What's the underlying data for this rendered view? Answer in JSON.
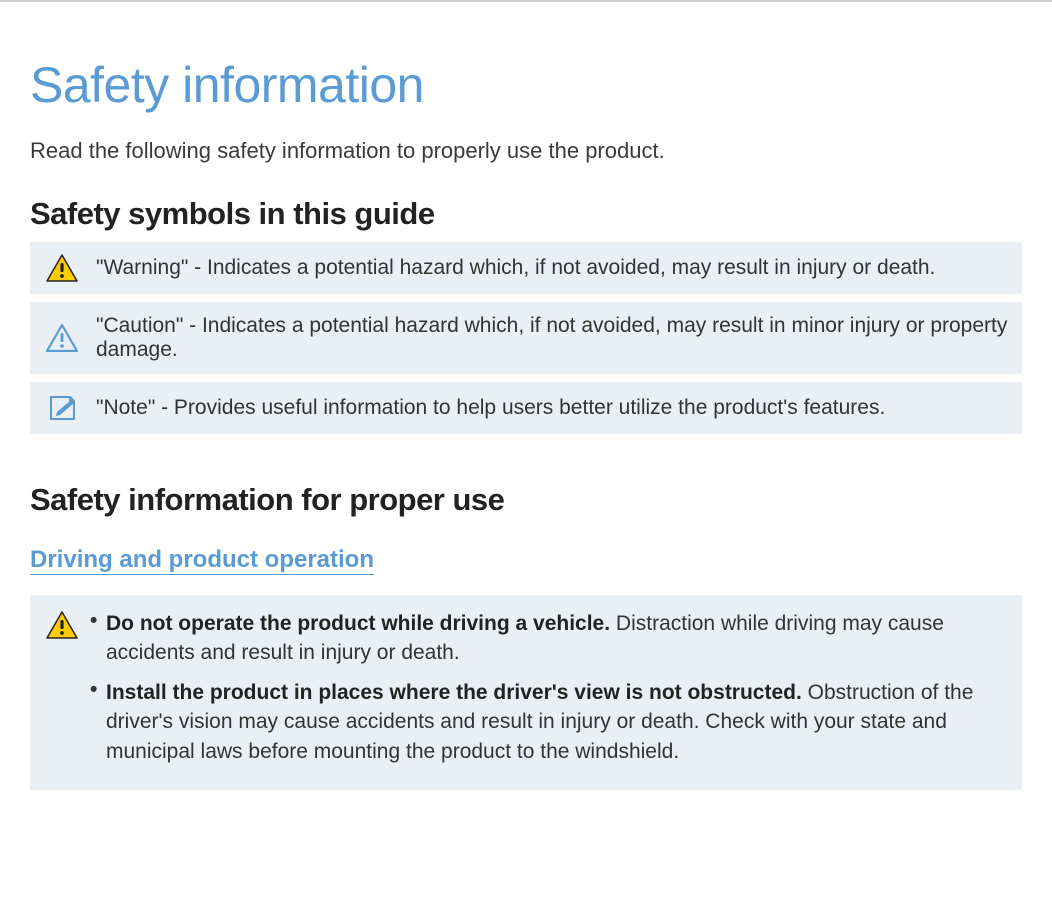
{
  "title": "Safety information",
  "intro": "Read the following safety information to properly use the product.",
  "section_symbols_heading": "Safety symbols in this guide",
  "symbols": {
    "warning": "\"Warning\" - Indicates a potential hazard which, if not avoided, may result in injury or death.",
    "caution": "\"Caution\" - Indicates a potential hazard which, if not avoided, may result in minor injury or property damage.",
    "note": "\"Note\" - Provides useful information to help users better utilize the product's features."
  },
  "section_proper_use_heading": "Safety information for proper use",
  "subsection_driving_heading": "Driving and product operation",
  "warnings": {
    "item1_bold": "Do not operate the product while driving a vehicle.",
    "item1_rest": " Distraction while driving may cause accidents and result in injury or death.",
    "item2_bold": "Install the product in places where the driver's view is not obstructed.",
    "item2_rest": " Obstruction of the driver's vision may cause accidents and result in injury or death. Check with your state and municipal laws before mounting the product to the windshield."
  }
}
